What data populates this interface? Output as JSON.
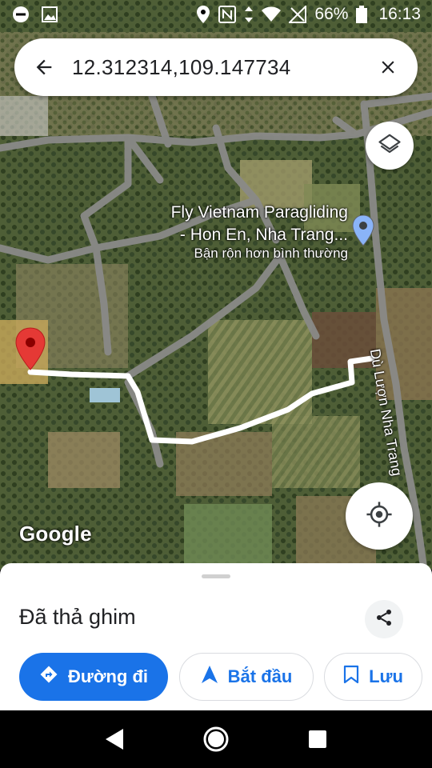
{
  "status_bar": {
    "battery": "66%",
    "time": "16:13",
    "icons": [
      "dnd-icon",
      "gallery-icon",
      "location-icon",
      "nfc-icon",
      "data-icon",
      "wifi-icon",
      "signal-icon",
      "battery-icon"
    ]
  },
  "search": {
    "query": "12.312314,109.147734",
    "back_icon": "arrow-left-icon",
    "clear_icon": "close-icon"
  },
  "map": {
    "poi_name_line1": "Fly Vietnam Paragliding",
    "poi_name_line2": "- Hon En, Nha Trang...",
    "poi_status": "Bận rộn hơn bình thường",
    "road_label": "Dù Lượn Nha Trang",
    "logo": "Google",
    "pin_color": "#e53935",
    "route_color": "#ffffff",
    "poi_pin_color": "#8ab4f8"
  },
  "sheet": {
    "title": "Đã thả ghim",
    "share_icon": "share-icon",
    "actions": [
      {
        "label": "Đường đi",
        "icon": "directions-icon"
      },
      {
        "label": "Bắt đầu",
        "icon": "navigation-arrow-icon"
      },
      {
        "label": "Lưu",
        "icon": "bookmark-icon"
      }
    ],
    "accent": "#1a73e8"
  },
  "nav_bar": {
    "buttons": [
      "back-triangle-icon",
      "home-circle-icon",
      "recents-square-icon"
    ]
  }
}
